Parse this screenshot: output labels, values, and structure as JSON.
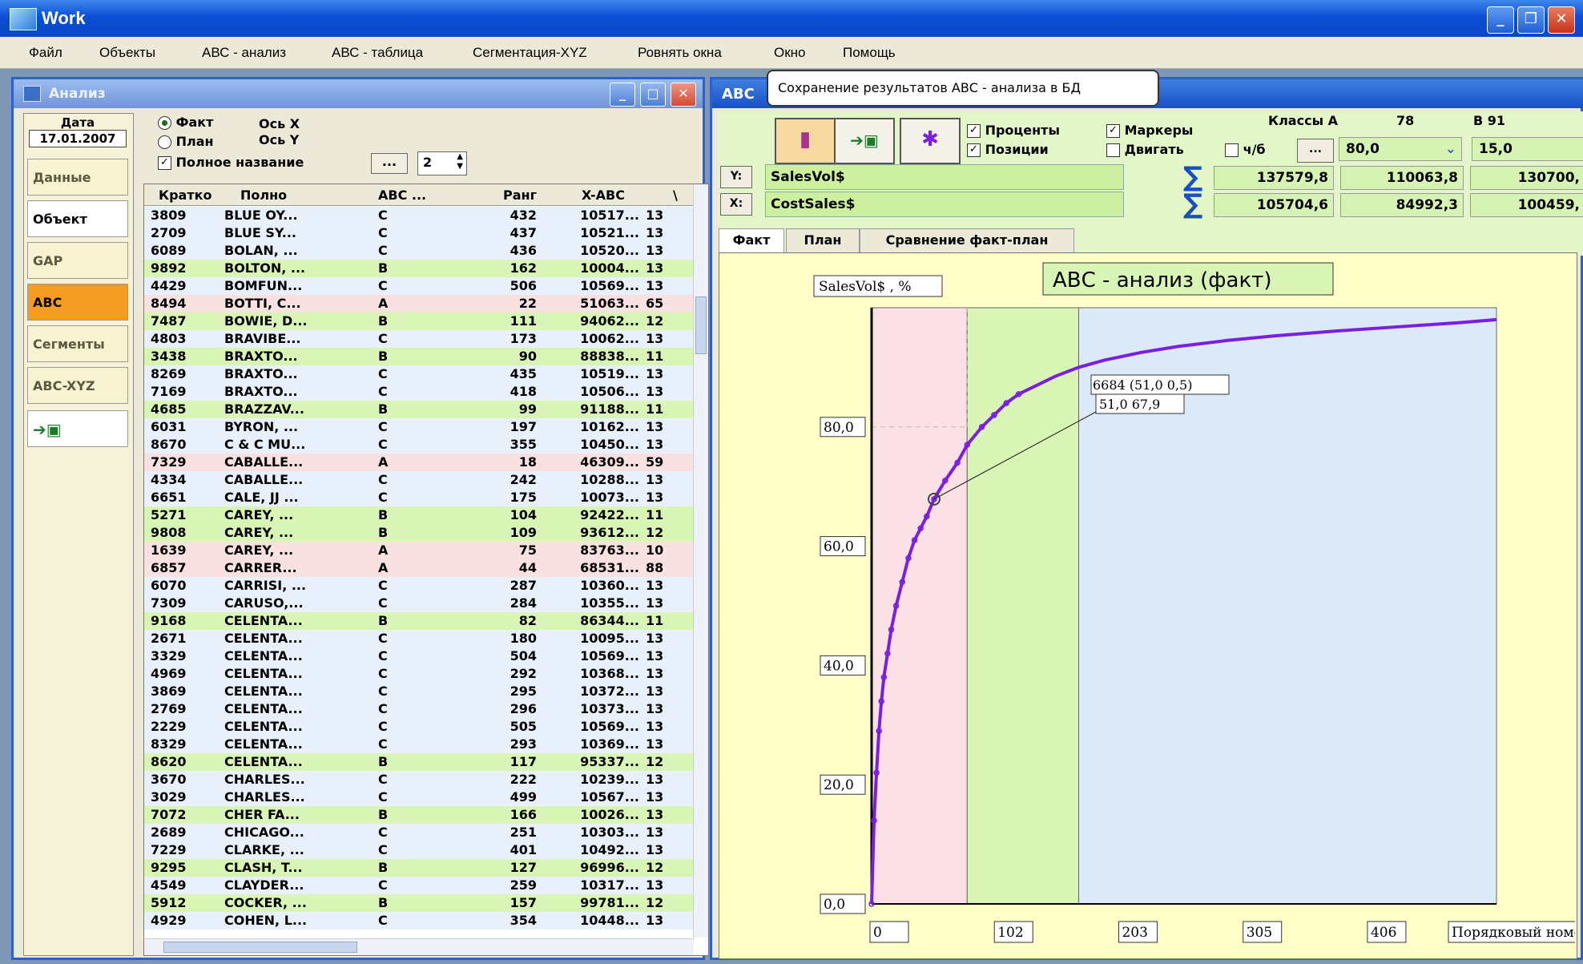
{
  "app": {
    "title": "Work"
  },
  "menu": [
    "Файл",
    "Объекты",
    "АВС - анализ",
    "АВС - таблица",
    "Сегментация-XYZ",
    "Ровнять окна",
    "Окно",
    "Помощь"
  ],
  "left_window": {
    "title": "Анализ",
    "date_label": "Дата",
    "date_value": "17.01.2007",
    "sidebar": [
      "Данные",
      "Объект",
      "GAP",
      "ABC",
      "Сегменты",
      "ABC-XYZ"
    ],
    "options": {
      "fact": "Факт",
      "plan": "План",
      "axis_x": "Ось X",
      "axis_y": "Ось Y",
      "full_name": "Полное название",
      "dots": "...",
      "spin_value": "2"
    },
    "columns": [
      "Кратко",
      "Полно",
      "ABC ...",
      "Ранг",
      "X-ABC",
      "\\"
    ],
    "rows": [
      [
        "3809",
        "BLUE OY...",
        "C",
        "432",
        "10517...",
        "13"
      ],
      [
        "2709",
        "BLUE SY...",
        "C",
        "437",
        "10521...",
        "13"
      ],
      [
        "6089",
        "BOLAN, ...",
        "C",
        "436",
        "10520...",
        "13"
      ],
      [
        "9892",
        "BOLTON, ...",
        "B",
        "162",
        "10004...",
        "13"
      ],
      [
        "4429",
        "BOMFUN...",
        "C",
        "506",
        "10569...",
        "13"
      ],
      [
        "8494",
        "BOTTI, C...",
        "A",
        "22",
        "51063...",
        "65"
      ],
      [
        "7487",
        "BOWIE, D...",
        "B",
        "111",
        "94062...",
        "12"
      ],
      [
        "4803",
        "BRAVIBE...",
        "C",
        "173",
        "10062...",
        "13"
      ],
      [
        "3438",
        "BRAXTO...",
        "B",
        "90",
        "88838...",
        "11"
      ],
      [
        "8269",
        "BRAXTO...",
        "C",
        "435",
        "10519...",
        "13"
      ],
      [
        "7169",
        "BRAXTO...",
        "C",
        "418",
        "10506...",
        "13"
      ],
      [
        "4685",
        "BRAZZAV...",
        "B",
        "99",
        "91188...",
        "11"
      ],
      [
        "6031",
        "BYRON, ...",
        "C",
        "197",
        "10162...",
        "13"
      ],
      [
        "8670",
        "C & C MU...",
        "C",
        "355",
        "10450...",
        "13"
      ],
      [
        "7329",
        "CABALLE...",
        "A",
        "18",
        "46309...",
        "59"
      ],
      [
        "4334",
        "CABALLE...",
        "C",
        "242",
        "10288...",
        "13"
      ],
      [
        "6651",
        "CALE, JJ ...",
        "C",
        "175",
        "10073...",
        "13"
      ],
      [
        "5271",
        "CAREY, ...",
        "B",
        "104",
        "92422...",
        "11"
      ],
      [
        "9808",
        "CAREY, ...",
        "B",
        "109",
        "93612...",
        "12"
      ],
      [
        "1639",
        "CAREY, ...",
        "A",
        "75",
        "83763...",
        "10"
      ],
      [
        "6857",
        "CARRER...",
        "A",
        "44",
        "68531...",
        "88"
      ],
      [
        "6070",
        "CARRISI, ...",
        "C",
        "287",
        "10360...",
        "13"
      ],
      [
        "7309",
        "CARUSO,...",
        "C",
        "284",
        "10355...",
        "13"
      ],
      [
        "9168",
        "CELENTA...",
        "B",
        "82",
        "86344...",
        "11"
      ],
      [
        "2671",
        "CELENTA...",
        "C",
        "180",
        "10095...",
        "13"
      ],
      [
        "3329",
        "CELENTA...",
        "C",
        "504",
        "10569...",
        "13"
      ],
      [
        "4969",
        "CELENTA...",
        "C",
        "292",
        "10368...",
        "13"
      ],
      [
        "3869",
        "CELENTA...",
        "C",
        "295",
        "10372...",
        "13"
      ],
      [
        "2769",
        "CELENTA...",
        "C",
        "296",
        "10373...",
        "13"
      ],
      [
        "2229",
        "CELENTA...",
        "C",
        "505",
        "10569...",
        "13"
      ],
      [
        "8329",
        "CELENTA...",
        "C",
        "293",
        "10369...",
        "13"
      ],
      [
        "8620",
        "CELENTA...",
        "B",
        "117",
        "95337...",
        "12"
      ],
      [
        "3670",
        "CHARLES...",
        "C",
        "222",
        "10239...",
        "13"
      ],
      [
        "3029",
        "CHARLES...",
        "C",
        "499",
        "10567...",
        "13"
      ],
      [
        "7072",
        "CHER FA...",
        "B",
        "166",
        "10026...",
        "13"
      ],
      [
        "2689",
        "CHICAGO...",
        "C",
        "251",
        "10303...",
        "13"
      ],
      [
        "7229",
        "CLARKE, ...",
        "C",
        "401",
        "10492...",
        "13"
      ],
      [
        "9295",
        "CLASH, T...",
        "B",
        "127",
        "96996...",
        "12"
      ],
      [
        "4549",
        "CLAYDER...",
        "C",
        "259",
        "10317...",
        "13"
      ],
      [
        "5912",
        "COCKER, ...",
        "B",
        "157",
        "99781...",
        "12"
      ],
      [
        "4929",
        "COHEN, L...",
        "C",
        "354",
        "10448...",
        "13"
      ]
    ],
    "row_colors": {
      "A": "#f9e1e1",
      "B": "#d9f5b5",
      "C": "#e8f1fb"
    }
  },
  "right_window": {
    "title": "ABC",
    "tooltip": "Сохранение результатов АВС - анализа в БД",
    "checks": {
      "percent": "Проценты",
      "positions": "Позиции",
      "markers": "Маркеры",
      "move": "Двигать",
      "bw": "ч/б"
    },
    "classes_label": "Классы А",
    "class_a_count": "78",
    "class_b_label": "B 91",
    "class_a_value": "80,0",
    "class_b_value": "15,0",
    "dots": "...",
    "y_button": "Y:",
    "x_button": "X:",
    "y_field": "SalesVol$",
    "x_field": "CostSales$",
    "sum_y": [
      "137579,8",
      "110063,8",
      "130700,"
    ],
    "sum_x": [
      "105704,6",
      "84992,3",
      "100459,"
    ],
    "tabs": [
      "Факт",
      "План",
      "Сравнение факт-план"
    ]
  },
  "chart_data": {
    "type": "line",
    "title": "АВС - анализ (факт)",
    "ylabel": "SalesVol$ , %",
    "xlabel": "Порядковый номе",
    "x_ticks": [
      "0",
      "102",
      "203",
      "305",
      "406"
    ],
    "y_ticks": [
      "0,0",
      "20,0",
      "40,0",
      "60,0",
      "80,0"
    ],
    "xlim": [
      0,
      510
    ],
    "ylim": [
      0,
      100
    ],
    "zones": [
      {
        "name": "A",
        "from": 0,
        "to": 78,
        "color": "#fbe0e6"
      },
      {
        "name": "B",
        "from": 78,
        "to": 169,
        "color": "#d9f5b5"
      },
      {
        "name": "C",
        "from": 169,
        "to": 510,
        "color": "#dce9f9"
      }
    ],
    "series": [
      {
        "color": "#7a1ee0",
        "x": [
          0,
          2,
          4,
          6,
          8,
          10,
          13,
          16,
          20,
          25,
          30,
          35,
          40,
          45,
          51,
          60,
          70,
          78,
          90,
          100,
          110,
          120,
          135,
          150,
          169,
          190,
          220,
          250,
          290,
          330,
          380,
          430,
          480,
          510
        ],
        "y": [
          0,
          14,
          22,
          29,
          34,
          38,
          42,
          46,
          50,
          54,
          58,
          61,
          63,
          65,
          67.9,
          71,
          74,
          77,
          80,
          82,
          84,
          85.5,
          87,
          88.5,
          90,
          91.2,
          92.5,
          93.5,
          94.5,
          95.3,
          96.1,
          96.8,
          97.5,
          98
        ]
      }
    ],
    "annotations": [
      "6684 (51,0 0,5)",
      "51,0 67,9"
    ]
  }
}
